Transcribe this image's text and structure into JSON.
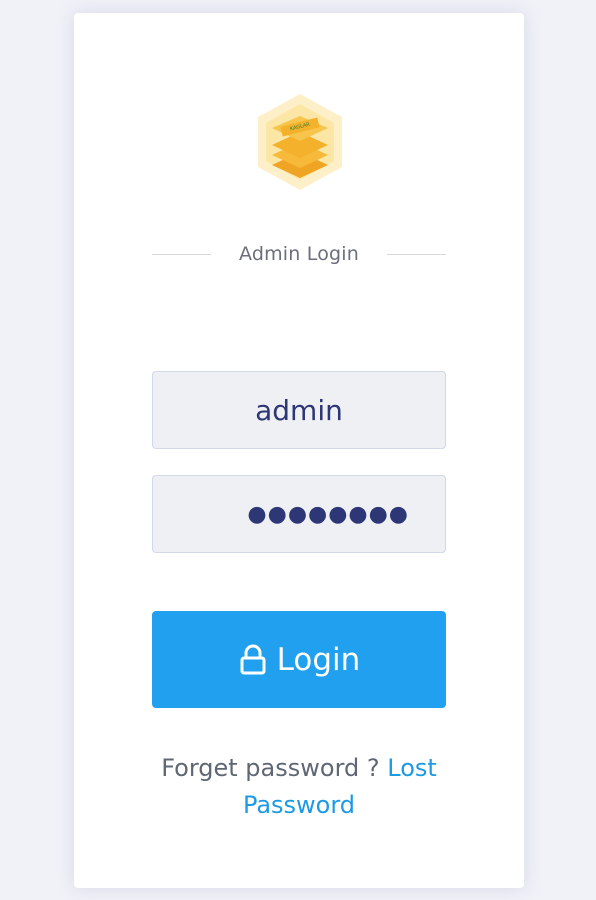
{
  "colors": {
    "background": "#f1f2f8",
    "card": "#ffffff",
    "field_fill": "#eef0f4",
    "field_text": "#2e3776",
    "button": "#21a0ef",
    "link": "#1d9ae4",
    "logo_gold": "#f3b12c",
    "logo_tile": "#fdf0c8"
  },
  "logo": {
    "icon": "stacked-layers-hexagon-logo",
    "label": "KAGLAR"
  },
  "header": {
    "title": "Admin Login"
  },
  "form": {
    "username": {
      "value": "admin"
    },
    "password": {
      "masked_value": "●●●●●●●●"
    },
    "login_button": {
      "icon": "lock-icon",
      "label": "Login"
    }
  },
  "footer": {
    "prompt": "Forget password ?",
    "link_text": "Lost Password"
  }
}
